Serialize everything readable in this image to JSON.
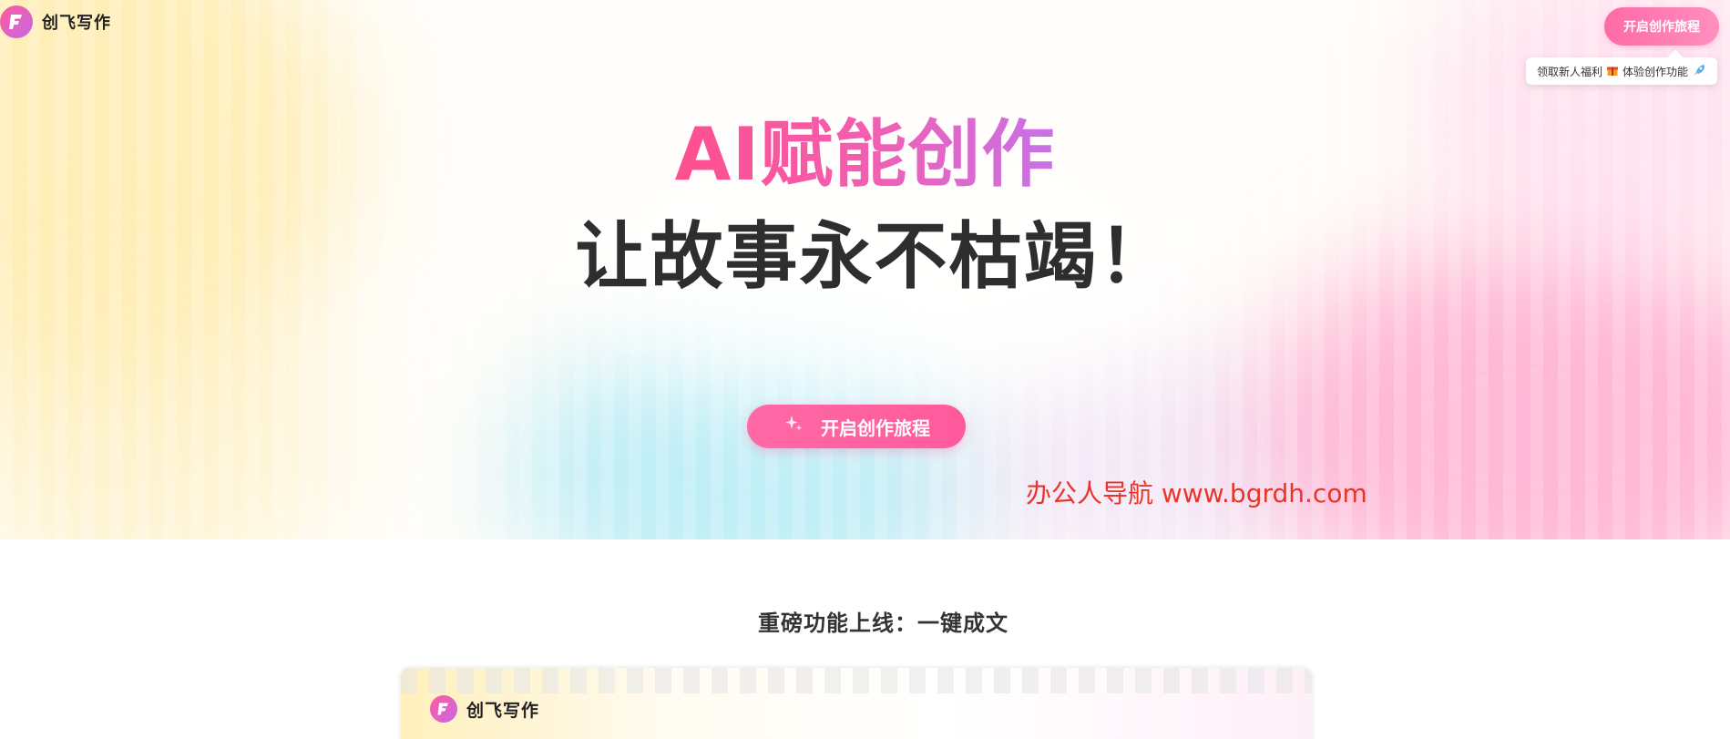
{
  "header": {
    "logo_text": "创飞写作",
    "cta_label": "开启创作旅程",
    "tooltip_text": "领取新人福利",
    "tooltip_text2": "体验创作功能"
  },
  "hero": {
    "headline_1": "AI赋能创作",
    "headline_2": "让故事永不枯竭！",
    "cta_label": "开启创作旅程",
    "watermark": "办公人导航 www.bgrdh.com"
  },
  "feature": {
    "title": "重磅功能上线：一键成文",
    "preview_logo_text": "创飞写作"
  },
  "colors": {
    "brand_pink": "#ff5a9c",
    "gradient_end": "#c871e8",
    "watermark_red": "#e8352b"
  },
  "icons": {
    "logo": "f-letter-icon",
    "sparkle": "sparkle-icon",
    "gift": "gift-icon",
    "rocket": "rocket-icon"
  }
}
